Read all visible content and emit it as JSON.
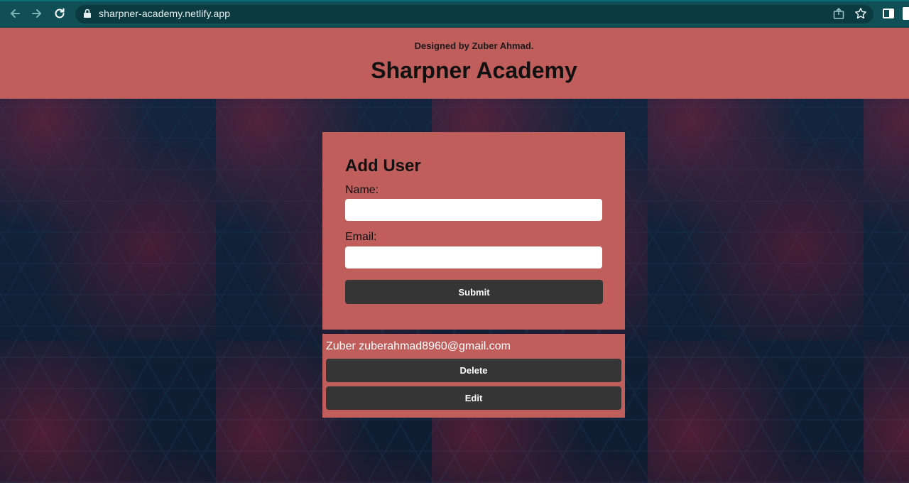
{
  "browser": {
    "url": "sharpner-academy.netlify.app",
    "icons": [
      "back-arrow-icon",
      "forward-arrow-icon",
      "reload-icon",
      "lock-icon",
      "share-icon",
      "star-icon",
      "side-panel-icon"
    ]
  },
  "header": {
    "credit": "Designed by Zuber Ahmad.",
    "title": "Sharpner Academy"
  },
  "form": {
    "heading": "Add User",
    "name_label": "Name:",
    "name_value": "",
    "email_label": "Email:",
    "email_value": "",
    "submit_label": "Submit"
  },
  "users": [
    {
      "text": "Zuber zuberahmad8960@gmail.com",
      "delete_label": "Delete",
      "edit_label": "Edit"
    }
  ],
  "colors": {
    "accent": "#c05e5c",
    "button": "#353535",
    "chrome": "#0f4f55"
  }
}
